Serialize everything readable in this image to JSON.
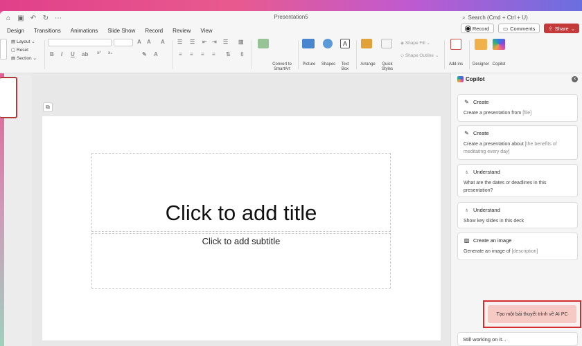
{
  "window": {
    "title": "Presentation5",
    "search_placeholder": "Search (Cmd + Ctrl + U)"
  },
  "tabs": [
    "Design",
    "Transitions",
    "Animations",
    "Slide Show",
    "Record",
    "Review",
    "View"
  ],
  "actions": {
    "record": "Record",
    "comments": "Comments",
    "share": "Share"
  },
  "ribbon": {
    "layout": "Layout",
    "reset": "Reset",
    "section": "Section",
    "convert_smartart": "Convert to SmartArt",
    "picture": "Picture",
    "shapes": "Shapes",
    "text_box": "Text Box",
    "arrange": "Arrange",
    "quick_styles": "Quick Styles",
    "shape_fill": "Shape Fill",
    "shape_outline": "Shape Outline",
    "add_ins": "Add-ins",
    "designer": "Designer",
    "copilot": "Copilot"
  },
  "slide": {
    "title_placeholder": "Click to add title",
    "subtitle_placeholder": "Click to add subtitle"
  },
  "copilot": {
    "header": "Copilot",
    "cards": [
      {
        "action": "Create",
        "text": "Create a presentation from ",
        "placeholder": "[file]",
        "icon": "pen-icon"
      },
      {
        "action": "Create",
        "text": "Create a presentation about ",
        "placeholder": "[the benefits of meditating every day]",
        "icon": "pen-icon"
      },
      {
        "action": "Understand",
        "text": "What are the dates or deadlines in this presentation?",
        "placeholder": "",
        "icon": "lightbulb-icon"
      },
      {
        "action": "Understand",
        "text": "Show key slides in this deck",
        "placeholder": "",
        "icon": "lightbulb-icon"
      },
      {
        "action": "Create an image",
        "text": "Generate an image of ",
        "placeholder": "[description]",
        "icon": "image-icon"
      }
    ],
    "prompt": "Tạo một bài thuyết trình về AI PC",
    "status": "Still working on it..."
  },
  "colors": {
    "accent_red": "#c43a3a",
    "highlight_border": "#d42c2c",
    "bubble": "#f7c9c4"
  }
}
